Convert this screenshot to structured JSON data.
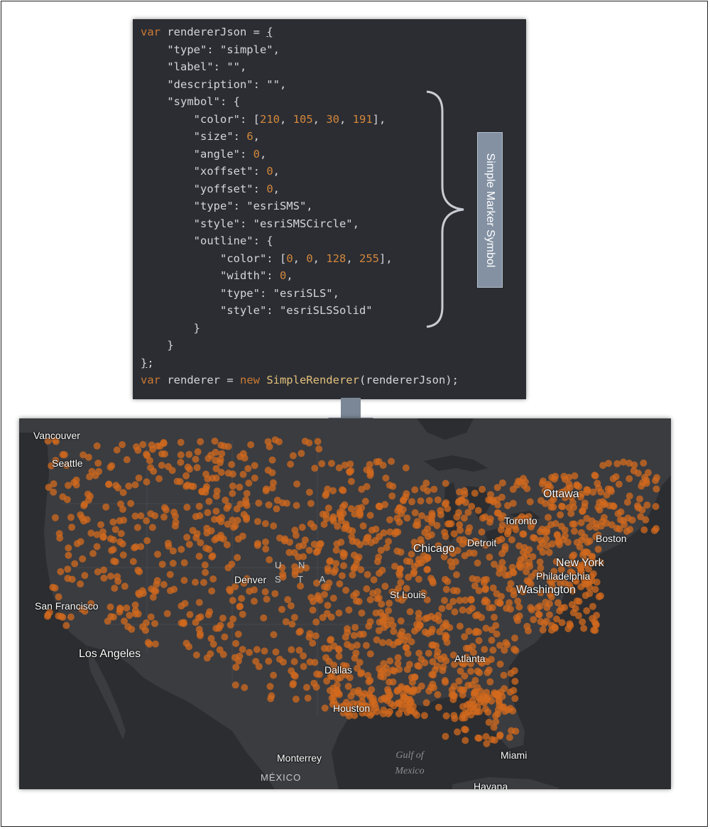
{
  "code": {
    "lines": [
      [
        [
          "kw",
          "var"
        ],
        [
          "",
          "rendererJson = "
        ],
        [
          "br-under",
          "{"
        ]
      ],
      [
        [
          "",
          "    \"type\": \"simple\","
        ]
      ],
      [
        [
          "",
          "    \"label\": \"\","
        ]
      ],
      [
        [
          "",
          "    \"description\": \"\","
        ]
      ],
      [
        [
          "",
          "    \"symbol\": {"
        ]
      ],
      [
        [
          "",
          "        \"color\": ["
        ],
        [
          "num",
          "210"
        ],
        [
          "",
          ", "
        ],
        [
          "num",
          "105"
        ],
        [
          "",
          ", "
        ],
        [
          "num",
          "30"
        ],
        [
          "",
          ", "
        ],
        [
          "num",
          "191"
        ],
        [
          "",
          "],"
        ]
      ],
      [
        [
          "",
          "        \"size\": "
        ],
        [
          "num",
          "6"
        ],
        [
          "",
          ","
        ]
      ],
      [
        [
          "",
          "        \"angle\": "
        ],
        [
          "num",
          "0"
        ],
        [
          "",
          ","
        ]
      ],
      [
        [
          "",
          "        \"xoffset\": "
        ],
        [
          "num",
          "0"
        ],
        [
          "",
          ","
        ]
      ],
      [
        [
          "",
          "        \"yoffset\": "
        ],
        [
          "num",
          "0"
        ],
        [
          "",
          ","
        ]
      ],
      [
        [
          "",
          "        \"type\": \"esriSMS\","
        ]
      ],
      [
        [
          "",
          "        \"style\": \"esriSMSCircle\","
        ]
      ],
      [
        [
          "",
          "        \"outline\": {"
        ]
      ],
      [
        [
          "",
          "            \"color\": ["
        ],
        [
          "num",
          "0"
        ],
        [
          "",
          ", "
        ],
        [
          "num",
          "0"
        ],
        [
          "",
          ", "
        ],
        [
          "num",
          "128"
        ],
        [
          "",
          ", "
        ],
        [
          "num",
          "255"
        ],
        [
          "",
          "],"
        ]
      ],
      [
        [
          "",
          "            \"width\": "
        ],
        [
          "num",
          "0"
        ],
        [
          "",
          ","
        ]
      ],
      [
        [
          "",
          "            \"type\": \"esriSLS\","
        ]
      ],
      [
        [
          "",
          "            \"style\": \"esriSLSSolid\""
        ]
      ],
      [
        [
          "",
          "        }"
        ]
      ],
      [
        [
          "",
          "    }"
        ]
      ],
      [
        [
          "br-under",
          "}"
        ],
        [
          "",
          ";"
        ]
      ],
      [
        [
          "kw",
          "var"
        ],
        [
          "",
          "renderer = "
        ],
        [
          "kw",
          "new "
        ],
        [
          "fn",
          "SimpleRenderer"
        ],
        [
          "",
          "(rendererJson);"
        ]
      ]
    ]
  },
  "annotation": {
    "label": "Simple Marker Symbol"
  },
  "map": {
    "cities": {
      "vancouver": "Vancouver",
      "seattle": "Seattle",
      "san_francisco": "San Francisco",
      "los_angeles": "Los Angeles",
      "denver": "Denver",
      "dallas": "Dallas",
      "houston": "Houston",
      "monterrey": "Monterrey",
      "st_louis": "St Louis",
      "chicago": "Chicago",
      "detroit": "Detroit",
      "toronto": "Toronto",
      "ottawa": "Ottawa",
      "boston": "Boston",
      "new_york": "New York",
      "philadelphia": "Philadelphia",
      "washington": "Washington",
      "atlanta": "Atlanta",
      "miami": "Miami",
      "havana": "Havana"
    },
    "country_mexico": "MÉXICO",
    "us_label_row1": "U N",
    "us_label_row2": "S T A",
    "gulf_line1": "Gulf of",
    "gulf_line2": "Mexico",
    "marker_color": "#d2691e",
    "marker_opacity": 0.75,
    "land_color": "#3a3c40",
    "water_color": "#2b2d30"
  }
}
